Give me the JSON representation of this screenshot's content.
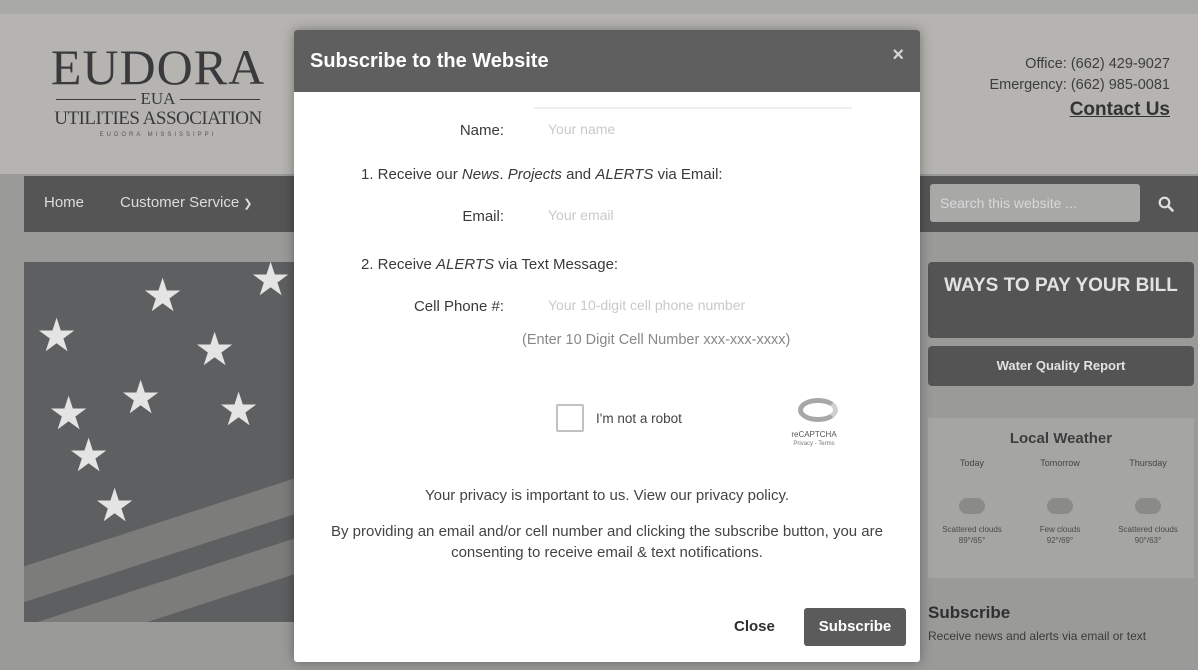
{
  "site": {
    "logo": {
      "main": "EUDORA",
      "abbr": "EUA",
      "sub": "UTILITIES ASSOCIATION",
      "tag": "EUDORA MISSISSIPPI"
    },
    "contact": {
      "office": "Office: (662) 429-9027",
      "emergency": "Emergency: (662) 985-0081",
      "link": "Contact Us"
    },
    "nav": {
      "home": "Home",
      "customer_service": "Customer Service"
    },
    "search": {
      "placeholder": "Search this website ..."
    },
    "sidebar": {
      "pay_button": "WAYS TO PAY YOUR BILL",
      "water_quality": "Water Quality Report",
      "weather": {
        "title": "Local Weather",
        "days": [
          {
            "label": "Today",
            "desc": "Scattered clouds",
            "temps": "89°/65°"
          },
          {
            "label": "Tomorrow",
            "desc": "Few clouds",
            "temps": "92°/69°"
          },
          {
            "label": "Thursday",
            "desc": "Scattered clouds",
            "temps": "90°/63°"
          }
        ]
      },
      "subscribe_title": "Subscribe",
      "subscribe_text": "Receive news and alerts via email or text"
    }
  },
  "modal": {
    "title": "Subscribe to the Website",
    "close_x": "×",
    "name_label": "Name:",
    "name_placeholder": "Your name",
    "email_intro_pre": "1. Receive our ",
    "email_intro_em1": "News",
    "email_intro_mid1": ". ",
    "email_intro_em2": "Projects",
    "email_intro_mid2": " and ",
    "email_intro_em3": "ALERTS",
    "email_intro_post": " via Email:",
    "email_label": "Email:",
    "email_placeholder": "Your email",
    "text_intro_pre": "2. Receive ",
    "text_intro_em": "ALERTS",
    "text_intro_post": " via Text Message:",
    "phone_label": "Cell Phone #:",
    "phone_placeholder": "Your 10-digit cell phone number",
    "phone_hint": "(Enter 10 Digit Cell Number xxx-xxx-xxxx)",
    "captcha": {
      "label": "I'm not a robot",
      "brand": "reCAPTCHA",
      "terms": "Privacy - Terms"
    },
    "privacy": "Your privacy is important to us. View our privacy policy.",
    "consent": "By providing an email and/or cell number and clicking the subscribe button, you are consenting to receive email & text notifications.",
    "close_button": "Close",
    "subscribe_button": "Subscribe"
  },
  "colors": {
    "modal_header": "#5f5f5f",
    "subscribe_button": "#5b5b5b",
    "backdrop": "#9a9a98"
  }
}
